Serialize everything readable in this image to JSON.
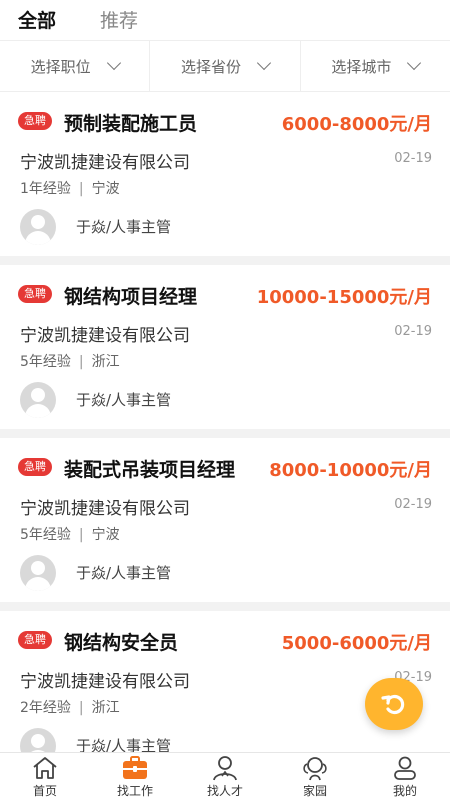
{
  "tabs": {
    "all": "全部",
    "recommended": "推荐"
  },
  "filters": [
    {
      "label": "选择职位"
    },
    {
      "label": "选择省份"
    },
    {
      "label": "选择城市"
    }
  ],
  "jobs": [
    {
      "badge": "急聘",
      "title": "预制装配施工员",
      "salary": "6000-8000元/月",
      "company": "宁波凯捷建设有限公司",
      "date": "02-19",
      "experience": "1年经验",
      "location": "宁波",
      "contact": "于焱/人事主管"
    },
    {
      "badge": "急聘",
      "title": "钢结构项目经理",
      "salary": "10000-15000元/月",
      "company": "宁波凯捷建设有限公司",
      "date": "02-19",
      "experience": "5年经验",
      "location": "浙江",
      "contact": "于焱/人事主管"
    },
    {
      "badge": "急聘",
      "title": "装配式吊装项目经理",
      "salary": "8000-10000元/月",
      "company": "宁波凯捷建设有限公司",
      "date": "02-19",
      "experience": "5年经验",
      "location": "宁波",
      "contact": "于焱/人事主管"
    },
    {
      "badge": "急聘",
      "title": "钢结构安全员",
      "salary": "5000-6000元/月",
      "company": "宁波凯捷建设有限公司",
      "date": "02-19",
      "experience": "2年经验",
      "location": "浙江",
      "contact": "于焱/人事主管"
    }
  ],
  "meta_separator": "|",
  "tabbar": [
    {
      "label": "首页",
      "icon": "home-icon"
    },
    {
      "label": "找工作",
      "icon": "briefcase-icon"
    },
    {
      "label": "找人才",
      "icon": "person-icon"
    },
    {
      "label": "家园",
      "icon": "community-icon"
    },
    {
      "label": "我的",
      "icon": "profile-icon"
    }
  ],
  "colors": {
    "accent": "#f05a28",
    "badge": "#e53935",
    "float_button": "#ffb52e",
    "active_tab_icon": "#f2731c"
  }
}
